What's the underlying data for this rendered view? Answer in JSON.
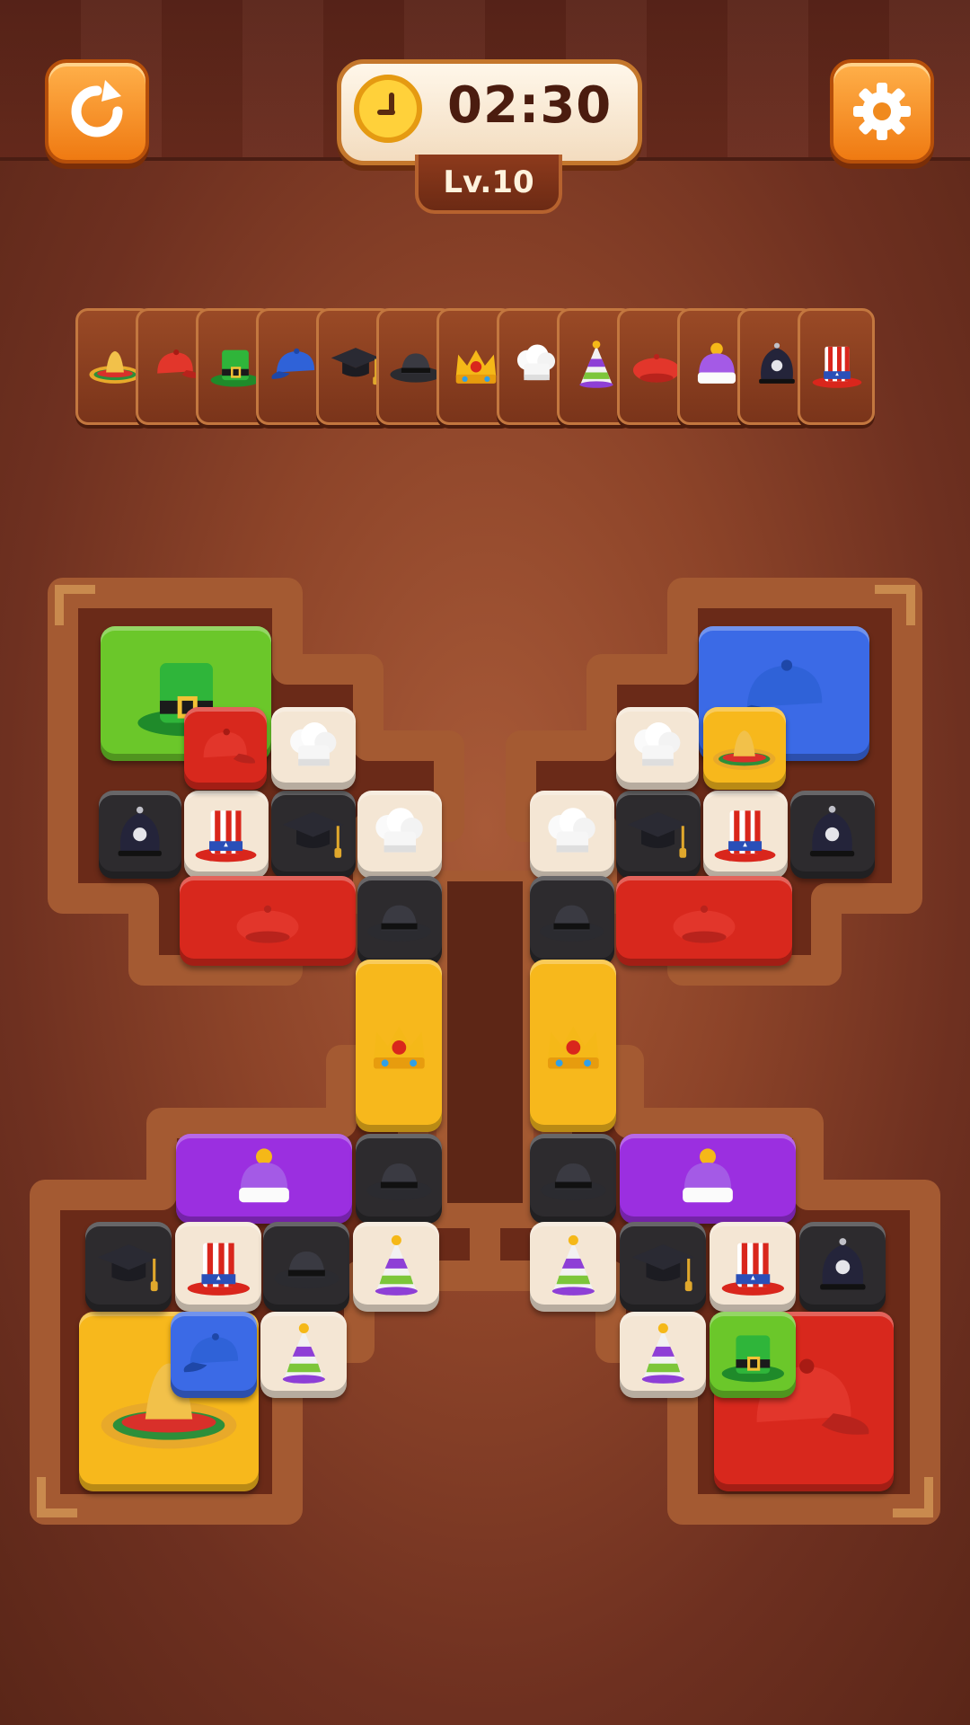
{
  "hud": {
    "timer": "02:30",
    "level": "Lv.10"
  },
  "colors": {
    "green": "#6bc72a",
    "red": "#d8281d",
    "cream": "#f4e6d4",
    "black": "#2d2b2e",
    "yellow": "#f7b81c",
    "blue": "#3b6ae6",
    "purple": "#9b2fe0"
  },
  "slot_bar": {
    "items": [
      "sombrero-icon",
      "red-cap-icon",
      "leprechaun-hat-icon",
      "blue-cap-icon",
      "graduation-cap-icon",
      "fedora-icon",
      "crown-icon",
      "chef-hat-icon",
      "party-hat-icon",
      "red-beret-icon",
      "purple-beanie-icon",
      "police-helmet-icon",
      "uncle-sam-hat-icon"
    ]
  },
  "board": {
    "tiles": [
      {
        "name": "tile-leprechaun-hat",
        "color": "green",
        "hat": "leprechaun-hat-icon"
      },
      {
        "name": "tile-red-cap",
        "color": "red",
        "hat": "red-cap-icon"
      },
      {
        "name": "tile-chef-hat",
        "color": "cream",
        "hat": "chef-hat-icon"
      },
      {
        "name": "tile-police-helmet",
        "color": "black",
        "hat": "police-helmet-icon"
      },
      {
        "name": "tile-uncle-sam-hat",
        "color": "cream",
        "hat": "uncle-sam-hat-icon"
      },
      {
        "name": "tile-graduation-cap",
        "color": "black",
        "hat": "graduation-cap-icon"
      },
      {
        "name": "tile-chef-hat",
        "color": "cream",
        "hat": "chef-hat-icon"
      },
      {
        "name": "tile-red-beret",
        "color": "red",
        "hat": "red-beret-icon"
      },
      {
        "name": "tile-fedora",
        "color": "black",
        "hat": "fedora-icon"
      },
      {
        "name": "tile-crown",
        "color": "yellow",
        "hat": "crown-icon"
      },
      {
        "name": "tile-purple-beanie",
        "color": "purple",
        "hat": "purple-beanie-icon"
      },
      {
        "name": "tile-fedora",
        "color": "black",
        "hat": "fedora-icon"
      },
      {
        "name": "tile-graduation-cap",
        "color": "black",
        "hat": "graduation-cap-icon"
      },
      {
        "name": "tile-uncle-sam-hat",
        "color": "cream",
        "hat": "uncle-sam-hat-icon"
      },
      {
        "name": "tile-fedora",
        "color": "black",
        "hat": "fedora-icon"
      },
      {
        "name": "tile-party-hat",
        "color": "cream",
        "hat": "party-hat-icon"
      },
      {
        "name": "tile-sombrero",
        "color": "yellow",
        "hat": "sombrero-icon"
      },
      {
        "name": "tile-blue-cap",
        "color": "blue",
        "hat": "blue-cap-icon"
      },
      {
        "name": "tile-party-hat",
        "color": "cream",
        "hat": "party-hat-icon"
      },
      {
        "name": "tile-blue-cap",
        "color": "blue",
        "hat": "blue-cap-icon"
      },
      {
        "name": "tile-chef-hat",
        "color": "cream",
        "hat": "chef-hat-icon"
      },
      {
        "name": "tile-sombrero",
        "color": "yellow",
        "hat": "sombrero-icon"
      },
      {
        "name": "tile-chef-hat",
        "color": "cream",
        "hat": "chef-hat-icon"
      },
      {
        "name": "tile-graduation-cap",
        "color": "black",
        "hat": "graduation-cap-icon"
      },
      {
        "name": "tile-uncle-sam-hat",
        "color": "cream",
        "hat": "uncle-sam-hat-icon"
      },
      {
        "name": "tile-police-helmet",
        "color": "black",
        "hat": "police-helmet-icon"
      },
      {
        "name": "tile-fedora",
        "color": "black",
        "hat": "fedora-icon"
      },
      {
        "name": "tile-red-beret",
        "color": "red",
        "hat": "red-beret-icon"
      },
      {
        "name": "tile-crown",
        "color": "yellow",
        "hat": "crown-icon"
      },
      {
        "name": "tile-fedora",
        "color": "black",
        "hat": "fedora-icon"
      },
      {
        "name": "tile-purple-beanie",
        "color": "purple",
        "hat": "purple-beanie-icon"
      },
      {
        "name": "tile-party-hat",
        "color": "cream",
        "hat": "party-hat-icon"
      },
      {
        "name": "tile-graduation-cap",
        "color": "black",
        "hat": "graduation-cap-icon"
      },
      {
        "name": "tile-uncle-sam-hat",
        "color": "cream",
        "hat": "uncle-sam-hat-icon"
      },
      {
        "name": "tile-police-helmet",
        "color": "black",
        "hat": "police-helmet-icon"
      },
      {
        "name": "tile-party-hat",
        "color": "cream",
        "hat": "party-hat-icon"
      },
      {
        "name": "tile-leprechaun-hat",
        "color": "green",
        "hat": "leprechaun-hat-icon"
      },
      {
        "name": "tile-red-cap",
        "color": "red",
        "hat": "red-cap-icon"
      }
    ]
  }
}
